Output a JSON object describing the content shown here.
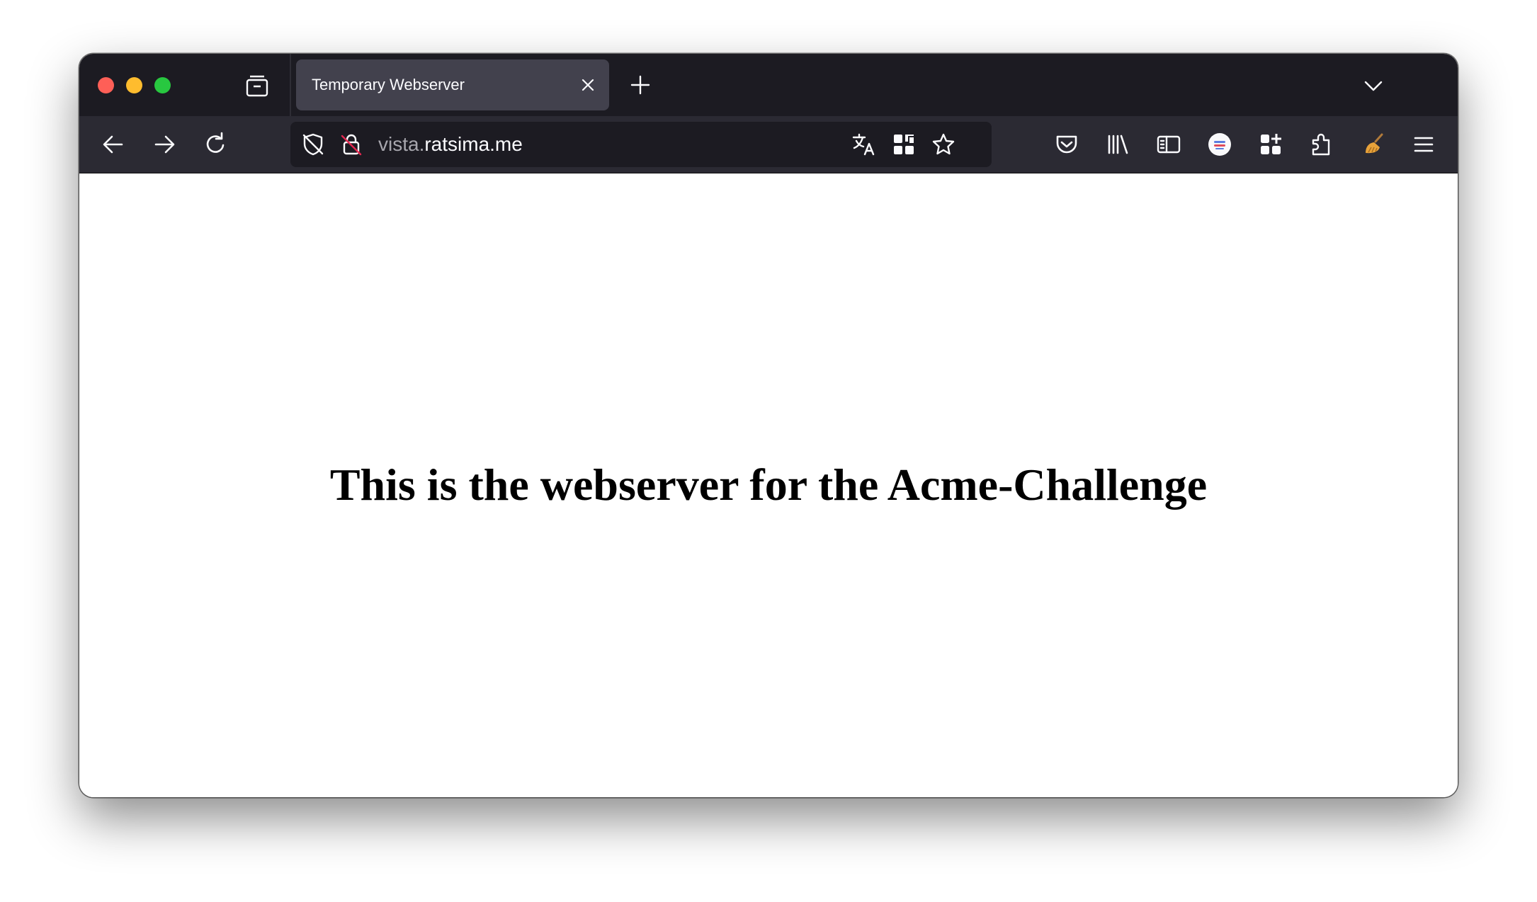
{
  "browser": {
    "tab": {
      "title": "Temporary Webserver",
      "close_icon": "close-icon"
    },
    "new_tab_icon": "plus-icon",
    "tab_list_icon": "chevron-down-icon",
    "firefox_view_icon": "firefox-view-icon",
    "nav": {
      "back_icon": "arrow-left-icon",
      "forward_icon": "arrow-right-icon",
      "reload_icon": "reload-icon"
    },
    "urlbar": {
      "subdomain": "vista.",
      "domain": "ratsima.me",
      "tracking_icon": "shield-off-icon",
      "lock_icon": "insecure-lock-icon",
      "translate_icon": "translate-icon",
      "qr_icon": "qr-code-icon",
      "bookmark_icon": "star-icon"
    },
    "toolbar_icons": [
      "pocket-icon",
      "library-icon",
      "sidebar-icon",
      "account-avatar-icon",
      "extensions-grid-icon",
      "puzzle-icon",
      "broom-icon",
      "hamburger-menu-icon"
    ]
  },
  "colors": {
    "tab_strip": "#1c1b22",
    "toolbar": "#2b2a33",
    "active_tab": "#42414d",
    "text": "#fbfbfe",
    "url_host_dim": "#a7a6ad",
    "traffic_red": "#fe5f57",
    "traffic_yellow": "#febc2e",
    "traffic_green": "#28c840"
  },
  "page": {
    "heading": "This is the webserver for the Acme-Challenge"
  }
}
